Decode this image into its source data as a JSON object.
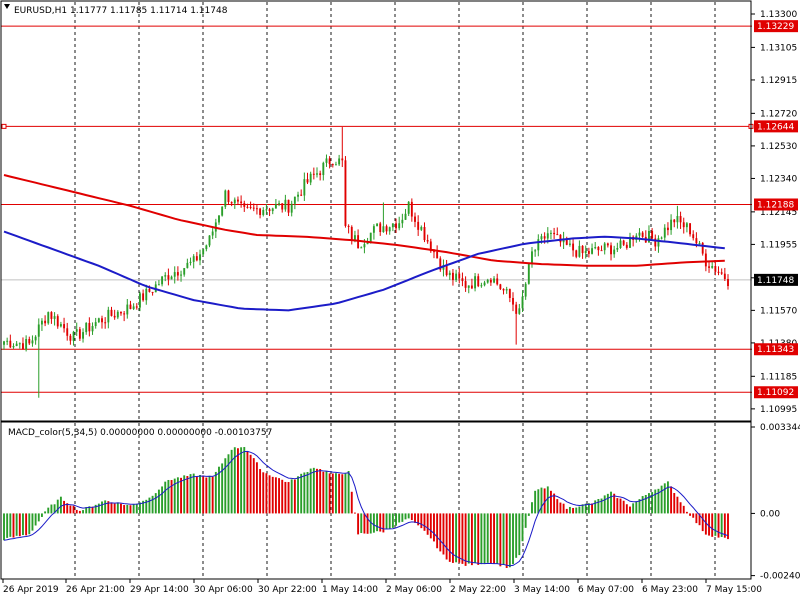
{
  "colors": {
    "bull": "#2a9e2a",
    "bear": "#e00000",
    "ma_slow": "#e00000",
    "ma_fast": "#1c1cc8",
    "hline": "#e00000",
    "label_bg": "#e00000",
    "current_bg": "#000000",
    "macd_signal": "#1c1cc8",
    "hist_up": "#2a9e2a",
    "hist_down": "#e00000"
  },
  "chart_data": [
    {
      "type": "candlestick",
      "title": "EURUSD,H1  1.11777 1.11785 1.11714 1.11748",
      "ylim": [
        1.1093,
        1.1337
      ],
      "x_labels": [
        "26 Apr 2019",
        "26 Apr 21:00",
        "29 Apr 14:00",
        "30 Apr 06:00",
        "30 Apr 22:00",
        "1 May 14:00",
        "2 May 06:00",
        "2 May 22:00",
        "3 May 14:00",
        "6 May 07:00",
        "6 May 23:00",
        "7 May 15:00"
      ],
      "y_ticks": [
        "1.13300",
        "1.13105",
        "1.12915",
        "1.12720",
        "1.12530",
        "1.12340",
        "1.12145",
        "1.11955",
        "1.11760",
        "1.11570",
        "1.11380",
        "1.11185",
        "1.10995"
      ],
      "hlines": [
        {
          "value": 1.13229,
          "label": "1.13229"
        },
        {
          "value": 1.12644,
          "label": "1.12644"
        },
        {
          "value": 1.12188,
          "label": "1.12188"
        },
        {
          "value": 1.11343,
          "label": "1.11343"
        },
        {
          "value": 1.11092,
          "label": "1.11092"
        }
      ],
      "current": {
        "value": 1.11748,
        "label": "1.11748"
      },
      "ma_fast": [
        [
          0,
          1.1203
        ],
        [
          15,
          1.1193
        ],
        [
          30,
          1.1183
        ],
        [
          45,
          1.1171
        ],
        [
          60,
          1.1163
        ],
        [
          75,
          1.1158
        ],
        [
          90,
          1.1157
        ],
        [
          105,
          1.1161
        ],
        [
          120,
          1.1169
        ],
        [
          135,
          1.118
        ],
        [
          150,
          1.119
        ],
        [
          165,
          1.1196
        ],
        [
          180,
          1.1199
        ],
        [
          190,
          1.12
        ],
        [
          200,
          1.1199
        ],
        [
          215,
          1.1196
        ],
        [
          229,
          1.1193
        ]
      ],
      "ma_slow": [
        [
          0,
          1.1236
        ],
        [
          20,
          1.1227
        ],
        [
          40,
          1.1218
        ],
        [
          55,
          1.121
        ],
        [
          70,
          1.1204
        ],
        [
          80,
          1.1201
        ],
        [
          95,
          1.12
        ],
        [
          110,
          1.1198
        ],
        [
          125,
          1.1195
        ],
        [
          140,
          1.1191
        ],
        [
          155,
          1.1186
        ],
        [
          170,
          1.1184
        ],
        [
          185,
          1.1183
        ],
        [
          200,
          1.1183
        ],
        [
          215,
          1.1185
        ],
        [
          229,
          1.1186
        ]
      ],
      "anchors": [
        [
          0,
          1.1139
        ],
        [
          8,
          1.1137
        ],
        [
          14,
          1.1156
        ],
        [
          22,
          1.1141
        ],
        [
          30,
          1.1151
        ],
        [
          40,
          1.1159
        ],
        [
          46,
          1.1168
        ],
        [
          52,
          1.1178
        ],
        [
          60,
          1.1185
        ],
        [
          65,
          1.1198
        ],
        [
          70,
          1.1225
        ],
        [
          76,
          1.1214
        ],
        [
          82,
          1.1217
        ],
        [
          90,
          1.1218
        ],
        [
          96,
          1.1232
        ],
        [
          104,
          1.1246
        ],
        [
          107,
          1.1243
        ],
        [
          108,
          1.1205
        ],
        [
          112,
          1.1196
        ],
        [
          118,
          1.1205
        ],
        [
          125,
          1.1209
        ],
        [
          128,
          1.1218
        ],
        [
          134,
          1.1198
        ],
        [
          140,
          1.1178
        ],
        [
          146,
          1.1172
        ],
        [
          154,
          1.1177
        ],
        [
          160,
          1.1164
        ],
        [
          163,
          1.1155
        ],
        [
          167,
          1.119
        ],
        [
          172,
          1.1202
        ],
        [
          177,
          1.1195
        ],
        [
          183,
          1.119
        ],
        [
          190,
          1.1193
        ],
        [
          196,
          1.1194
        ],
        [
          200,
          1.1203
        ],
        [
          206,
          1.1198
        ],
        [
          212,
          1.121
        ],
        [
          217,
          1.1204
        ],
        [
          222,
          1.1186
        ],
        [
          226,
          1.118
        ],
        [
          229,
          1.1175
        ]
      ],
      "spikes": [
        {
          "i": 11,
          "low": 1.1106
        },
        {
          "i": 107,
          "high": 1.1264
        },
        {
          "i": 162,
          "low": 1.1137
        },
        {
          "i": 120,
          "high": 1.122
        },
        {
          "i": 213,
          "high": 1.1218
        }
      ]
    },
    {
      "type": "histogram",
      "title": "MACD_color(5,34,5) 0.00000000 0.00000000 -0.00103757",
      "ylim": [
        -0.0025,
        0.0035
      ],
      "y_ticks": [
        "0.0033447",
        "0.00",
        "-0.0024073"
      ],
      "anchors": [
        [
          0,
          -0.001
        ],
        [
          8,
          -0.0008
        ],
        [
          14,
          0.0002
        ],
        [
          18,
          0.0006
        ],
        [
          24,
          0.0001
        ],
        [
          32,
          0.0005
        ],
        [
          40,
          0.0003
        ],
        [
          46,
          0.0006
        ],
        [
          52,
          0.0013
        ],
        [
          60,
          0.0015
        ],
        [
          66,
          0.0014
        ],
        [
          72,
          0.0025
        ],
        [
          76,
          0.0026
        ],
        [
          82,
          0.0016
        ],
        [
          90,
          0.0012
        ],
        [
          98,
          0.0018
        ],
        [
          104,
          0.0015
        ],
        [
          109,
          0.0016
        ],
        [
          112,
          -0.0008
        ],
        [
          120,
          -0.0007
        ],
        [
          128,
          -0.0002
        ],
        [
          134,
          -0.0008
        ],
        [
          140,
          -0.0018
        ],
        [
          146,
          -0.002
        ],
        [
          154,
          -0.0019
        ],
        [
          160,
          -0.0021
        ],
        [
          163,
          -0.0016
        ],
        [
          168,
          0.0009
        ],
        [
          172,
          0.001
        ],
        [
          178,
          0.0002
        ],
        [
          186,
          0.0004
        ],
        [
          192,
          0.0008
        ],
        [
          198,
          0.0003
        ],
        [
          204,
          0.0008
        ],
        [
          210,
          0.0012
        ],
        [
          216,
          0.0001
        ],
        [
          222,
          -0.0008
        ],
        [
          229,
          -0.001
        ]
      ]
    }
  ]
}
